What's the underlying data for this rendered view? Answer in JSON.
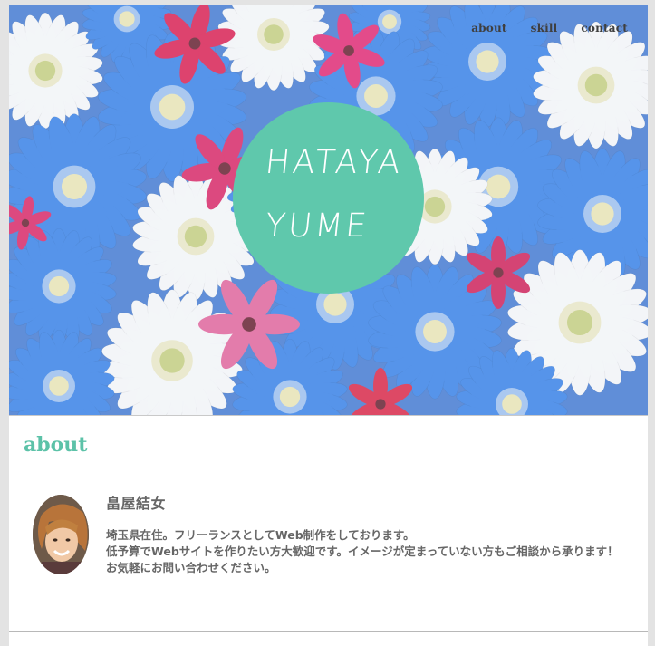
{
  "nav": {
    "items": [
      {
        "label": "about"
      },
      {
        "label": "skill"
      },
      {
        "label": "contact"
      }
    ]
  },
  "hero": {
    "logo_line1": "HATAYA",
    "logo_line2": "YUME",
    "logo_color": "#5fc8ac"
  },
  "about": {
    "heading": "about",
    "accent_color": "#5cc2a8",
    "name": "畠屋結女",
    "bio": [
      "埼玉県在住。フリーランスとしてWeb制作をしております。",
      "低予算でWebサイトを作りたい方大歓迎です。イメージが定まっていない方もご相談から承ります！",
      "お気軽にお問い合わせください。"
    ]
  }
}
